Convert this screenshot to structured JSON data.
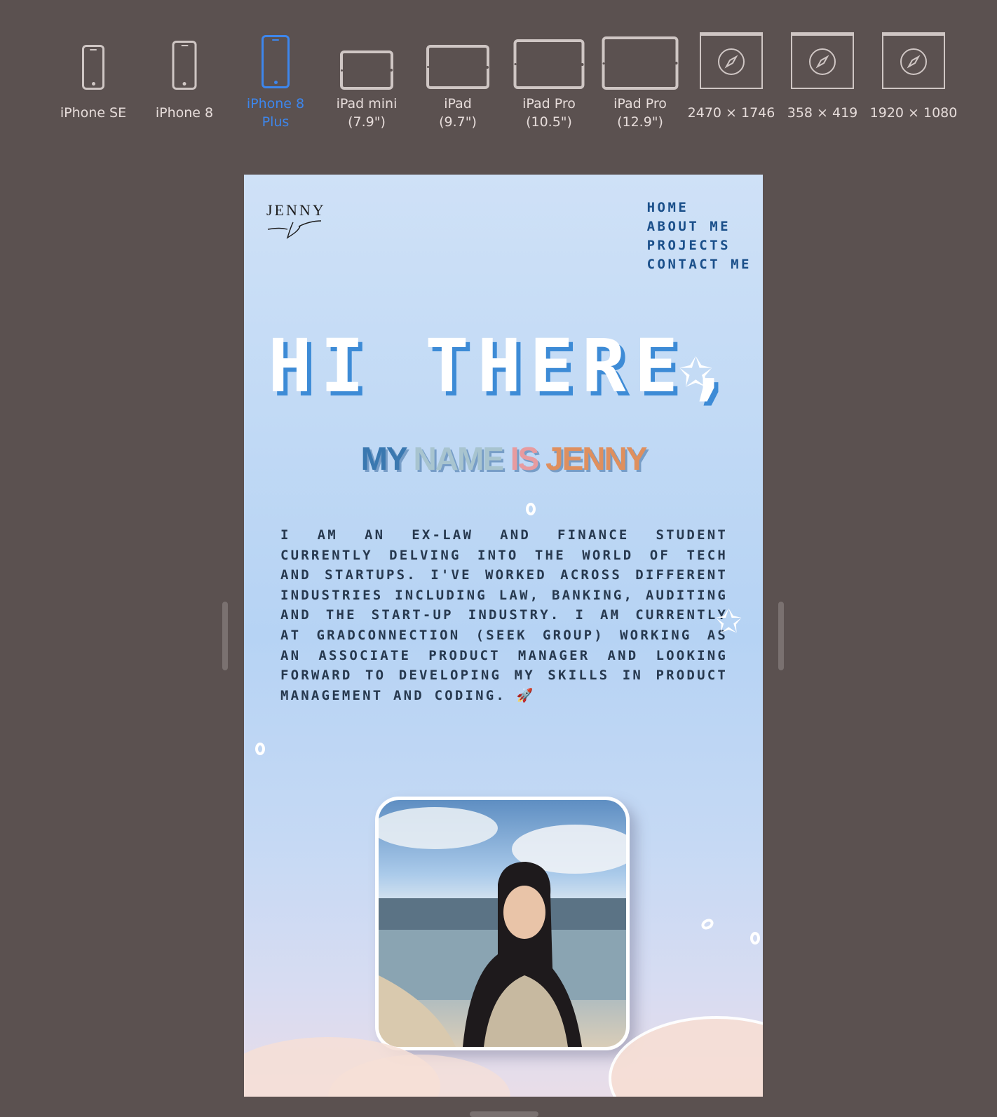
{
  "toolbar": {
    "devices": [
      {
        "label": "iPhone SE"
      },
      {
        "label": "iPhone 8"
      },
      {
        "label": "iPhone 8 Plus",
        "active": true
      },
      {
        "label": "iPad mini (7.9\")"
      },
      {
        "label": "iPad (9.7\")"
      },
      {
        "label": "iPad Pro (10.5\")"
      },
      {
        "label": "iPad Pro (12.9\")"
      },
      {
        "label": "2470 × 1746"
      },
      {
        "label": "358 × 419"
      },
      {
        "label": "1920 × 1080"
      }
    ],
    "active_color": "#3d86ec"
  },
  "site": {
    "logo_name": "JENNY",
    "nav": [
      "HOME",
      "ABOUT ME",
      "PROJECTS",
      "CONTACT ME"
    ],
    "hero": "HI THERE,",
    "name_words": [
      {
        "text": "MY",
        "color": "#3a78b0"
      },
      {
        "text": "NAME",
        "color": "#a8c4cf"
      },
      {
        "text": "IS",
        "color": "#e79b9f"
      },
      {
        "text": "JENNY",
        "color": "#df8f5e"
      }
    ],
    "bio": "I am an ex-law and finance student currently delving into the world of tech and startups. I've worked across different industries including law, banking, auditing and the start-up industry. I am currently at GradConnection (SEEK Group) working as an Associate Product Manager and looking forward to developing my skills in product management and coding. 🚀"
  }
}
